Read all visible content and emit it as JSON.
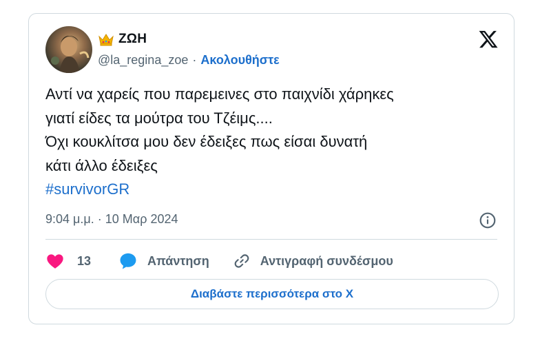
{
  "author": {
    "display_name": "ΖΩΗ",
    "handle": "@la_regina_zoe",
    "separator": "·",
    "follow_label": "Ακολουθήστε",
    "name_emoji_icon": "crown-icon",
    "avatar_icon": "avatar-image"
  },
  "brand": {
    "logo_icon": "x-logo-icon"
  },
  "tweet": {
    "lines": [
      "Αντί να χαρείς που παρεμεινες στο παιχνίδι χάρηκες",
      "γιατί είδες τα μούτρα του Τζέιμς....",
      "Όχι κουκλίτσα μου δεν έδειξες πως είσαι δυνατή",
      "κάτι άλλο έδειξες"
    ],
    "hashtag": "#survivorGR",
    "timestamp": "9:04 μ.μ. · 10 Μαρ 2024",
    "info_icon": "info-icon"
  },
  "actions": {
    "like_count": "13",
    "like_icon": "heart-icon",
    "reply_label": "Απάντηση",
    "reply_icon": "speech-bubble-icon",
    "copy_label": "Αντιγραφή συνδέσμου",
    "copy_icon": "link-icon"
  },
  "read_more_label": "Διαβάστε περισσότερα στο X",
  "colors": {
    "accent": "#1d6fcc",
    "text": "#0f1419",
    "muted": "#536471",
    "border": "#cfd9de",
    "heart": "#f91880"
  }
}
